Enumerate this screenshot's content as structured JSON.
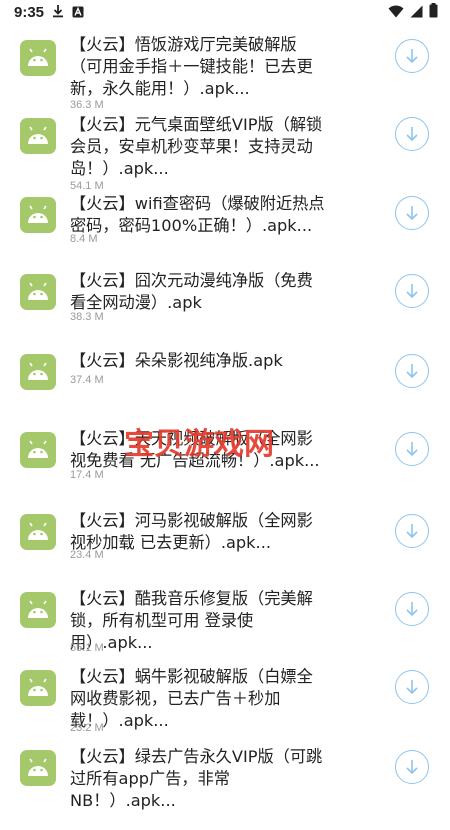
{
  "status_bar": {
    "time": "9:35",
    "left_icons": [
      "download-icon",
      "a-letter-icon"
    ],
    "right_icons": [
      "wifi-icon",
      "signal-icon",
      "battery-icon"
    ]
  },
  "watermark": "宝贝游戏网",
  "colors": {
    "app_icon_bg": "#a4c86a",
    "download_button_border": "#8ec4ee",
    "size_text": "#9a9a9a",
    "watermark": "#e53b2c"
  },
  "items": [
    {
      "title": "【火云】悟饭游戏厅完美破解版（可用金手指＋一键技能！已去更新，永久能用！）.apk...",
      "size": "36.3 M"
    },
    {
      "title": "【火云】元气桌面壁纸VIP版（解锁会员，安卓机秒变苹果！支持灵动岛！）.apk...",
      "size": "54.1 M"
    },
    {
      "title": "【火云】wifi查密码（爆破附近热点密码，密码100%正确！）.apk...",
      "size": "8.4 M"
    },
    {
      "title": "【火云】囧次元动漫纯净版（免费看全网动漫）.apk",
      "size": "38.3 M"
    },
    {
      "title": "【火云】朵朵影视纯净版.apk",
      "size": "37.4 M"
    },
    {
      "title": "【火云】天天视频破解版（全网影视免费看 无广告超流畅！）.apk...",
      "size": "17.4 M"
    },
    {
      "title": "【火云】河马影视破解版（全网影视秒加载 已去更新）.apk...",
      "size": "23.4 M"
    },
    {
      "title": "【火云】酷我音乐修复版（完美解锁，所有机型可用 登录使用）.apk...",
      "size": "55.1 M"
    },
    {
      "title": "【火云】蜗牛影视破解版（白嫖全网收费影视，已去广告＋秒加载！）.apk...",
      "size": "23.2 M"
    },
    {
      "title": "【火云】绿去广告永久VIP版（可跳过所有app广告，非常NB！）.apk...",
      "size": ""
    }
  ]
}
